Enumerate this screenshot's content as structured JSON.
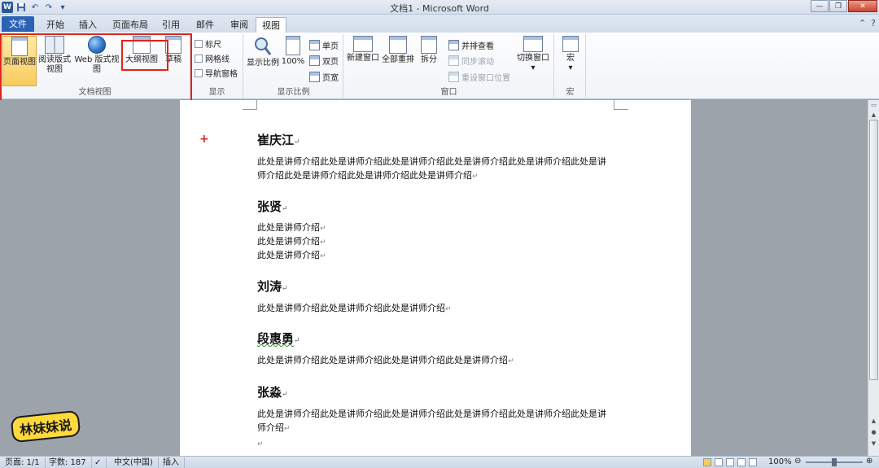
{
  "window": {
    "title": "文档1 - Microsoft Word",
    "logo": "W",
    "undo": "↶",
    "redo": "↷",
    "minimize": "—",
    "restore": "❐",
    "close": "✕"
  },
  "tabs": [
    {
      "label": "文件"
    },
    {
      "label": "开始"
    },
    {
      "label": "插入"
    },
    {
      "label": "页面布局"
    },
    {
      "label": "引用"
    },
    {
      "label": "邮件"
    },
    {
      "label": "审阅"
    },
    {
      "label": "视图"
    }
  ],
  "ribbon_ctrl": {
    "help": "?",
    "collapse": "⌃"
  },
  "groups": {
    "document_views": {
      "label": "文档视图",
      "buttons": [
        {
          "label": "页面视图",
          "selected": true
        },
        {
          "label": "阅读版式\n视图"
        },
        {
          "label": "Web 版式视图"
        },
        {
          "label": "大纲视图"
        },
        {
          "label": "草稿"
        }
      ]
    },
    "show": {
      "label": "显示",
      "items": [
        {
          "label": "标尺",
          "checked": false
        },
        {
          "label": "网格线",
          "checked": false
        },
        {
          "label": "导航窗格",
          "checked": false
        }
      ]
    },
    "zoom": {
      "label": "显示比例",
      "zoom_label": "显示比例",
      "hundred_label": "100%",
      "single": "单页",
      "double": "双页",
      "width": "页宽"
    },
    "window": {
      "label": "窗口",
      "new_window": "新建窗口",
      "arrange_all": "全部重排",
      "split": "拆分",
      "side_by_side": "并排查看",
      "sync_scroll": "同步滚动",
      "reset_position": "重设窗口位置",
      "switch": "切换窗口"
    },
    "macros": {
      "label": "宏",
      "button": "宏"
    }
  },
  "document": {
    "entries": [
      {
        "name": "崔庆江",
        "lines": [
          "此处是讲师介绍此处是讲师介绍此处是讲师介绍此处是讲师介绍此处是讲师介绍此处是讲",
          "师介绍此处是讲师介绍此处是讲师介绍此处是讲师介绍"
        ]
      },
      {
        "name": "张贤",
        "lines": [
          "此处是讲师介绍",
          "此处是讲师介绍",
          "此处是讲师介绍"
        ]
      },
      {
        "name": "刘涛",
        "lines": [
          "此处是讲师介绍此处是讲师介绍此处是讲师介绍"
        ]
      },
      {
        "name": "段惠勇",
        "lines": [
          "此处是讲师介绍此处是讲师介绍此处是讲师介绍此处是讲师介绍"
        ]
      },
      {
        "name": "张淼",
        "lines": [
          "此处是讲师介绍此处是讲师介绍此处是讲师介绍此处是讲师介绍此处是讲师介绍此处是讲",
          "师介绍"
        ]
      }
    ],
    "paragraph_mark": "↵",
    "plus_mark": "+"
  },
  "status": {
    "page": "页面: 1/1",
    "words": "字数: 187",
    "language": "中文(中国)",
    "mode": "插入",
    "zoom": "100%"
  },
  "watermark": "林妹妹说"
}
